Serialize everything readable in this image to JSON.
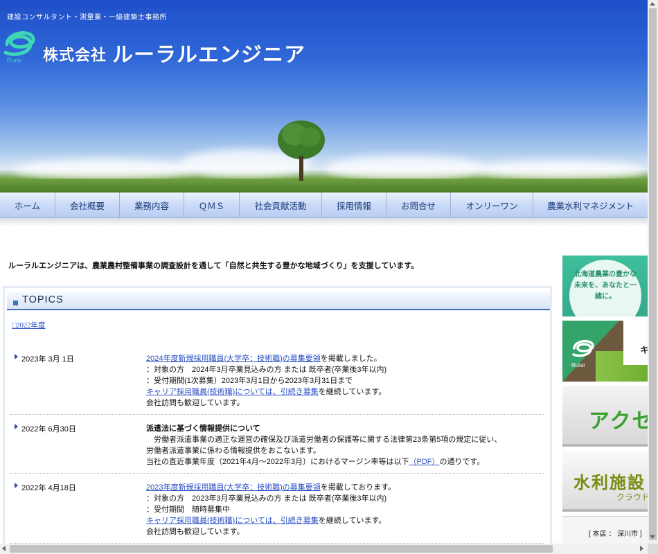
{
  "header": {
    "tagline": "建設コンサルタント・測量業・一級建築士事務所",
    "company_prefix": "株式会社",
    "company_name": "ルーラルエンジニア",
    "logo_text": "Rurai"
  },
  "nav": {
    "items": [
      {
        "label": "ホーム"
      },
      {
        "label": "会社概要"
      },
      {
        "label": "業務内容"
      },
      {
        "label": "ＱＭＳ"
      },
      {
        "label": "社会貢献活動"
      },
      {
        "label": "採用情報"
      },
      {
        "label": "お問合せ"
      },
      {
        "label": "オンリーワン"
      },
      {
        "label": "農業水利マネジメント"
      }
    ]
  },
  "lead": "ルーラルエンジニアは、農業農村整備事業の調査設計を通して「自然と共生する豊かな地域づくり」を支援しています。",
  "topics": {
    "title": "TOPICS",
    "year_link": "□2022年度",
    "news": [
      {
        "date": "2023年 3月 1日",
        "lines": [
          {
            "link": "2024年度新規採用職員(大学卒：技術職)の募集要領",
            "text": "を掲載しました。"
          },
          {
            "text": "：対象の方　2024年3月卒業見込みの方 または 既卒者(卒業後3年以内)"
          },
          {
            "text": "：受付期間(1次募集）2023年3月1日から2023年3月31日まで"
          },
          {
            "link": "キャリア採用職員(技術職)については、引続き募集",
            "text": "を継続しています。"
          },
          {
            "text": "会社訪問も歓迎しています。"
          }
        ]
      },
      {
        "date": "2022年 6月30日",
        "lines": [
          {
            "text": "派遣法に基づく情報提供について",
            "bold": true
          },
          {
            "text": "　労働者派遣事業の適正な運営の確保及び派遣労働者の保護等に関する法律第23条第5項の規定に従い、"
          },
          {
            "text": "労働者派遣事業に係わる情報提供をおこないます。"
          },
          {
            "text": "当社の直近事業年度（2021年4月～2022年3月）におけるマージン率等は以下",
            "link": "（PDF）",
            "after": "の通りです。"
          }
        ]
      },
      {
        "date": "2022年 4月18日",
        "lines": [
          {
            "link": "2023年度新規採用職員(大学卒：技術職)の募集要領",
            "text": "を掲載しております。"
          },
          {
            "text": "：対象の方　2023年3月卒業見込みの方 または 既卒者(卒業後3年以内)"
          },
          {
            "text": "：受付期間　随時募集中"
          },
          {
            "link": "キャリア採用職員(技術職)については、引続き募集",
            "text": "を継続しています。"
          },
          {
            "text": "会社訪問も歓迎しています。"
          }
        ]
      }
    ]
  },
  "sidebar": {
    "banner1": "北海道農業の豊かな未来を、あなたと一緒に。",
    "banner2_text": "キ",
    "banner2_logo": "Rurai",
    "banner3": "アクセ",
    "banner4": "水利施設",
    "banner4_sub": "クラウド",
    "banner5": "[ 本店 ： 深川市 ]"
  },
  "colors": {
    "accent": "#2a4fc4",
    "nav_text": "#1a3a7a",
    "topics_border": "#3f6fbf"
  }
}
